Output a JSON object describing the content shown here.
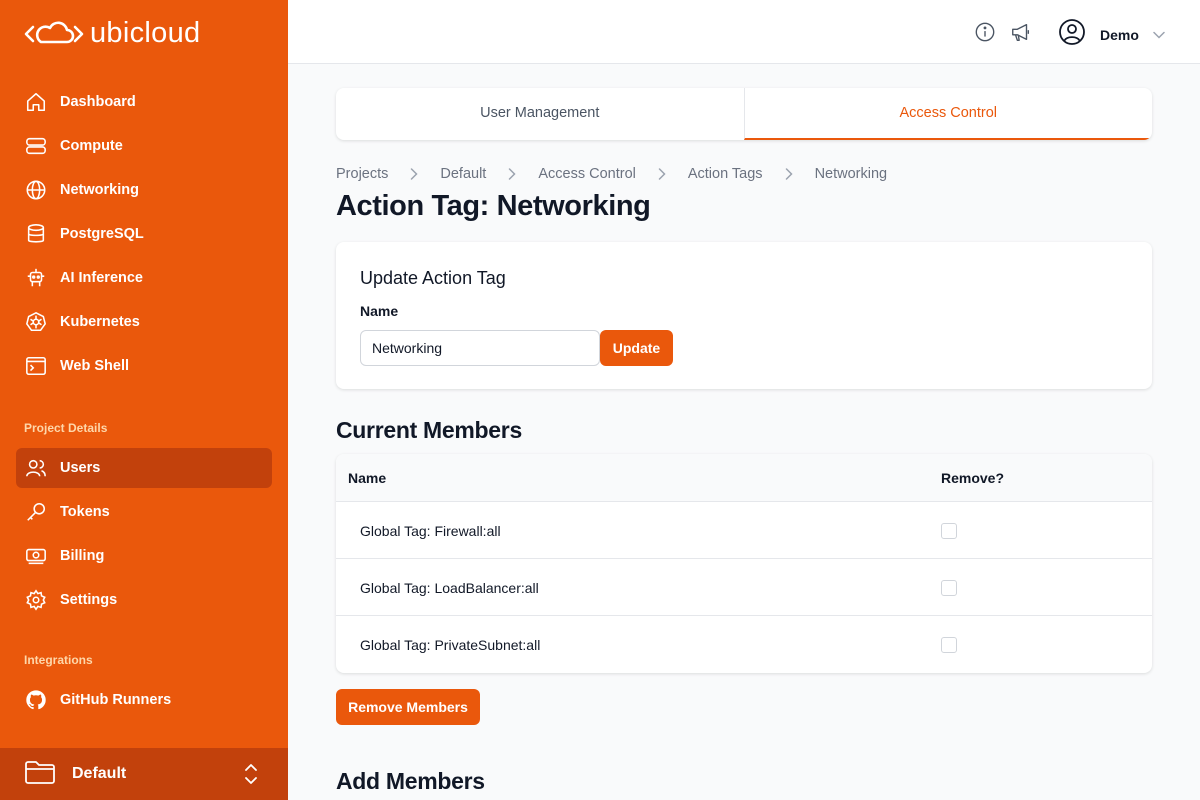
{
  "app": {
    "brand": "ubicloud",
    "accent_color": "#ea580c"
  },
  "sidebar": {
    "items": [
      {
        "label": "Dashboard",
        "icon": "home-icon"
      },
      {
        "label": "Compute",
        "icon": "server-icon"
      },
      {
        "label": "Networking",
        "icon": "globe-icon"
      },
      {
        "label": "PostgreSQL",
        "icon": "database-icon"
      },
      {
        "label": "AI Inference",
        "icon": "robot-icon"
      },
      {
        "label": "Kubernetes",
        "icon": "kubernetes-icon"
      },
      {
        "label": "Web Shell",
        "icon": "terminal-icon"
      }
    ],
    "project_details_title": "Project Details",
    "project_items": [
      {
        "label": "Users",
        "icon": "users-icon",
        "active": true
      },
      {
        "label": "Tokens",
        "icon": "key-icon"
      },
      {
        "label": "Billing",
        "icon": "banknote-icon"
      },
      {
        "label": "Settings",
        "icon": "gear-icon"
      }
    ],
    "integrations_title": "Integrations",
    "integration_items": [
      {
        "label": "GitHub Runners",
        "icon": "github-icon"
      }
    ],
    "project_switcher": {
      "label": "Default",
      "icon": "folder-icon"
    }
  },
  "header": {
    "user_name": "Demo"
  },
  "tabs": [
    {
      "label": "User Management",
      "active": false
    },
    {
      "label": "Access Control",
      "active": true
    }
  ],
  "breadcrumb": [
    "Projects",
    "Default",
    "Access Control",
    "Action Tags",
    "Networking"
  ],
  "page_title": "Action Tag: Networking",
  "update_card": {
    "title": "Update Action Tag",
    "name_label": "Name",
    "name_value": "Networking",
    "update_label": "Update"
  },
  "current_members": {
    "title": "Current Members",
    "columns": [
      "Name",
      "Remove?"
    ],
    "rows": [
      {
        "name": "Global Tag: Firewall:all",
        "checked": false
      },
      {
        "name": "Global Tag: LoadBalancer:all",
        "checked": false
      },
      {
        "name": "Global Tag: PrivateSubnet:all",
        "checked": false
      }
    ],
    "remove_label": "Remove Members"
  },
  "add_members": {
    "title": "Add Members"
  }
}
